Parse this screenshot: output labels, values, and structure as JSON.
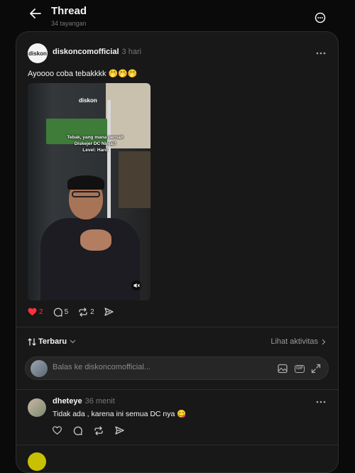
{
  "header": {
    "title": "Thread",
    "views": "34 tayangan"
  },
  "post": {
    "username": "diskoncomofficial",
    "time": "3 hari",
    "avatar_text": "diskon",
    "text": "Ayoooo coba tebakkkk 🤭🤭🤭",
    "video": {
      "watermark": "diskon",
      "overlay_line1": "Tebak, yang mana pernah",
      "overlay_line2": "Diskejer DC Ninja!!",
      "overlay_line3": "Level: Hard"
    },
    "likes": "2",
    "comments": "5",
    "reposts": "2",
    "liked_color": "#ff3040"
  },
  "sort": {
    "label": "Terbaru",
    "activity_label": "Lihat aktivitas"
  },
  "reply": {
    "placeholder": "Balas ke diskoncomofficial...",
    "gif_label": "GIF"
  },
  "comment": {
    "username": "dheteye",
    "time": "36 menit",
    "text": "Tidak ada , karena ini semua DC nya 😋"
  }
}
